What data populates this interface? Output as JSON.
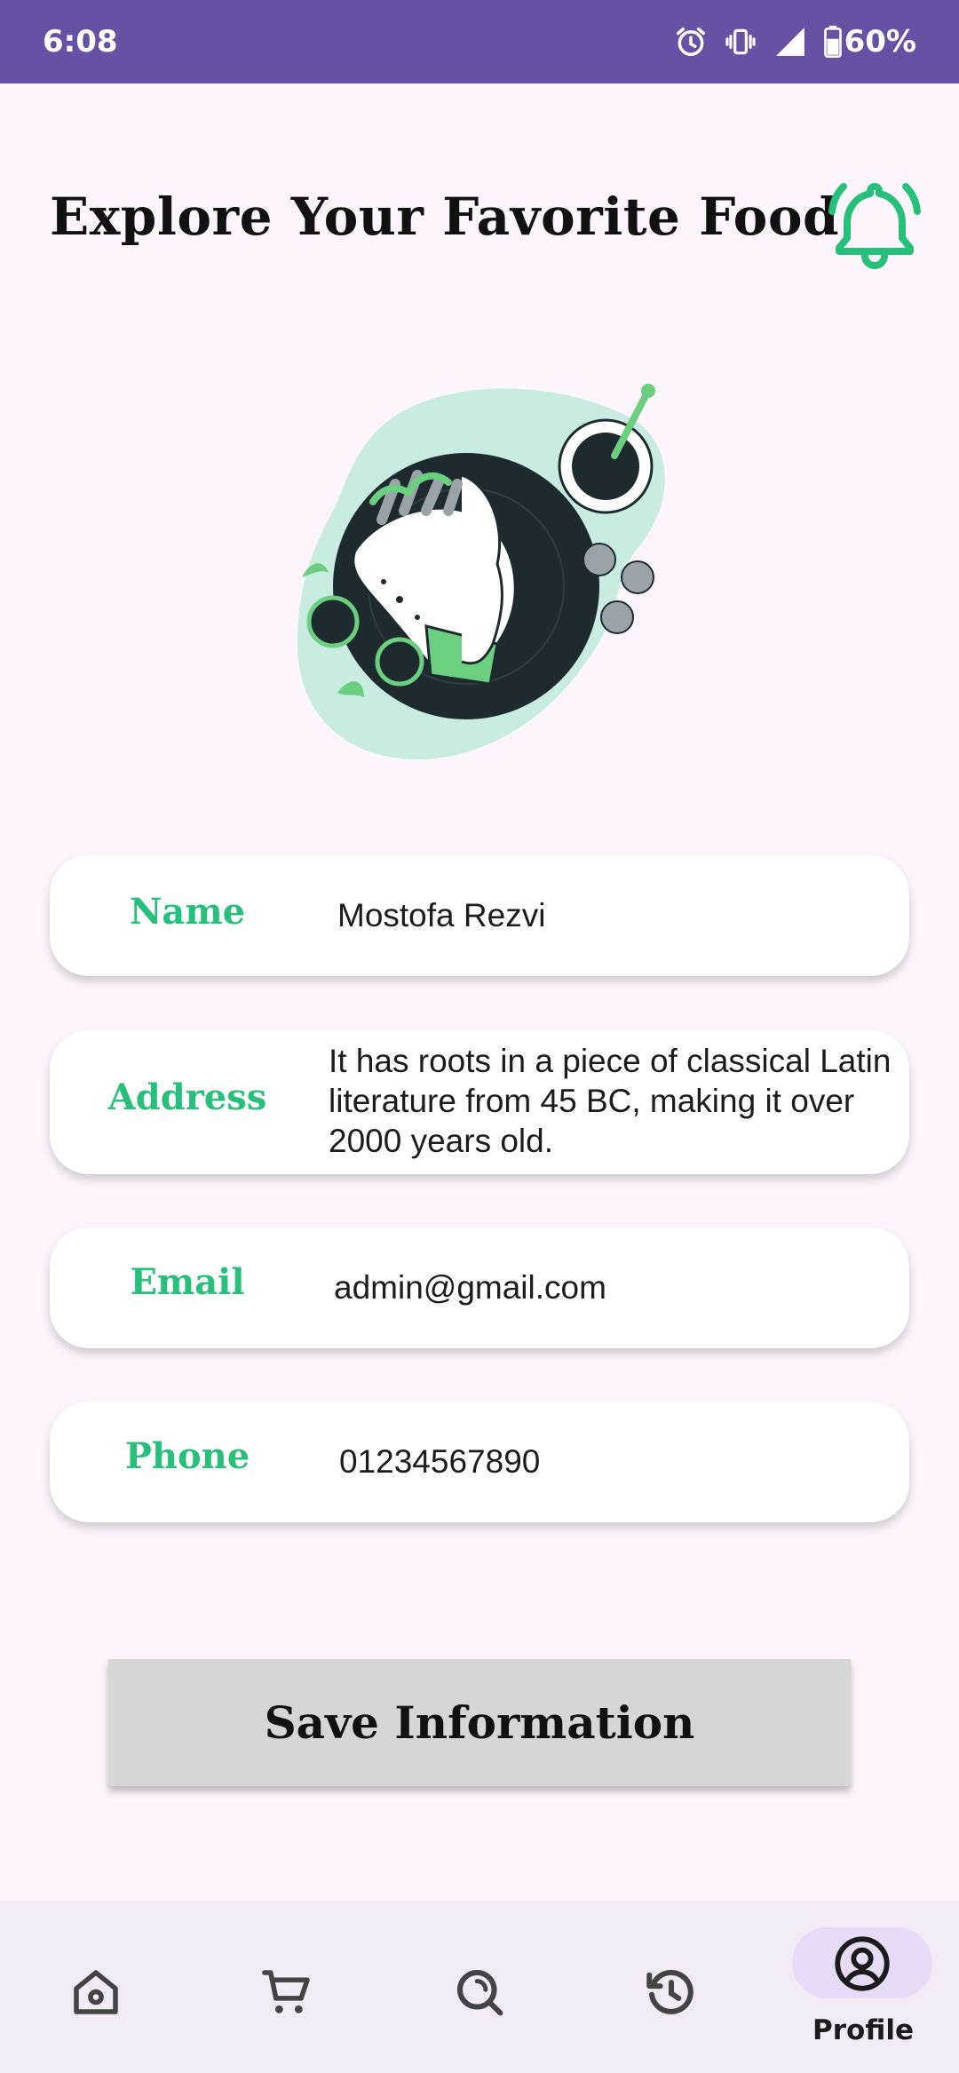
{
  "status_bar": {
    "time": "6:08",
    "battery_percent": "60%",
    "icons": [
      "alarm-icon",
      "vibrate-icon",
      "signal-icon",
      "battery-icon"
    ]
  },
  "header": {
    "title": "Explore Your Favorite Food",
    "bell_icon": "bell-icon"
  },
  "hero": {
    "illustration": "food-wrap-illustration"
  },
  "profile_fields": {
    "name": {
      "label": "Name",
      "value": "Mostofa Rezvi"
    },
    "address": {
      "label": "Address",
      "value_lines": [
        "It has roots in a piece of classical Latin",
        "literature from 45 BC, making it over",
        "2000 years old."
      ]
    },
    "email": {
      "label": "Email",
      "value": "admin@gmail.com"
    },
    "phone": {
      "label": "Phone",
      "value": "01234567890"
    }
  },
  "actions": {
    "save_label": "Save Information"
  },
  "bottom_nav": {
    "items": [
      {
        "icon": "home-icon",
        "label": ""
      },
      {
        "icon": "cart-icon",
        "label": ""
      },
      {
        "icon": "search-icon",
        "label": ""
      },
      {
        "icon": "history-icon",
        "label": ""
      },
      {
        "icon": "profile-icon",
        "label": "Profile",
        "selected": true
      }
    ]
  },
  "colors": {
    "status_bar": "#6651a4",
    "accent_green": "#27c07a",
    "background": "#fcf6fc",
    "nav_background": "#f1ebf5",
    "nav_selected_pill": "#e6dcf7",
    "button_background": "#d5d6d5"
  }
}
